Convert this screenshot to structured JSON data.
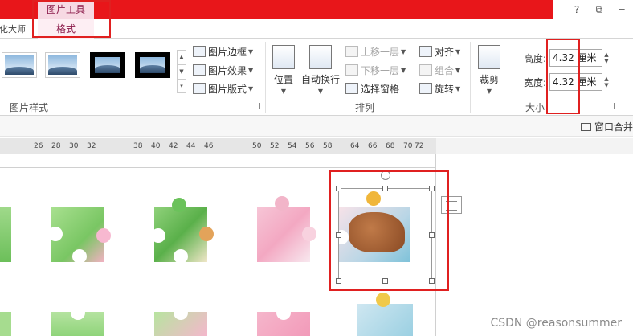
{
  "title_bar": {
    "context_tool": "图片工具",
    "help": "?",
    "restore": "⧉",
    "minimize": "🗕"
  },
  "tabs": {
    "left_partial": "美化大师",
    "format_tab": "格式"
  },
  "ribbon": {
    "picture_styles": {
      "group_label": "图片样式",
      "border_label": "图片边框",
      "effects_label": "图片效果",
      "layout_label": "图片版式"
    },
    "arrange": {
      "group_label": "排列",
      "position_label": "位置",
      "wrap_label": "自动换行",
      "bring_forward_label": "上移一层",
      "send_backward_label": "下移一层",
      "selection_pane_label": "选择窗格",
      "align_label": "对齐",
      "group_btn_label": "组合",
      "rotate_label": "旋转"
    },
    "size": {
      "group_label": "大小",
      "crop_label": "裁剪",
      "height_label": "高度:",
      "height_value": "4.32 厘米",
      "width_label": "宽度:",
      "width_value": "4.32 厘米"
    }
  },
  "pane_bar": {
    "merge_label": "窗口合并"
  },
  "ruler": {
    "ticks": [
      "26",
      "28",
      "30",
      "32",
      "38",
      "40",
      "42",
      "44",
      "46",
      "50",
      "52",
      "54",
      "56",
      "58",
      "64",
      "66",
      "68",
      "70",
      "72"
    ]
  },
  "watermark": "CSDN @reasonsummer",
  "colors": {
    "title_red": "#e8161a",
    "context_tab": "#f7d9e3",
    "context_text": "#8b1a4a",
    "highlight_red": "#e02020"
  }
}
